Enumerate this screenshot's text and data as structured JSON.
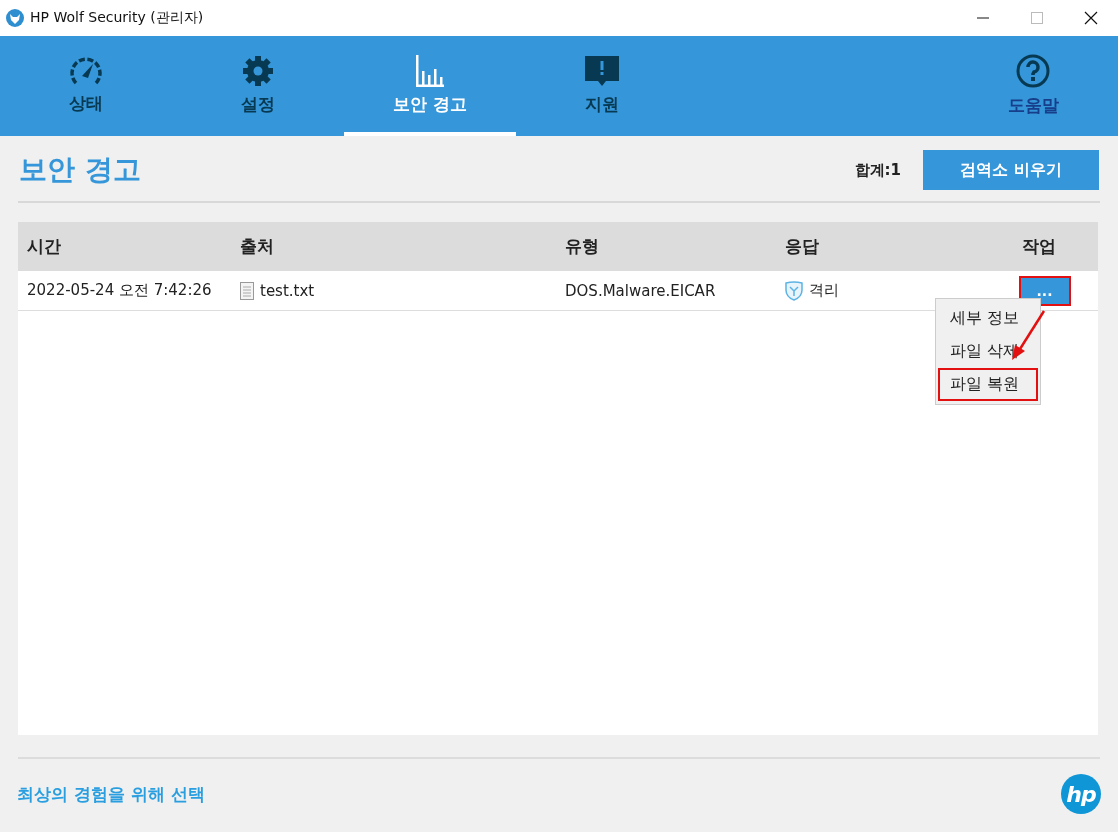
{
  "window": {
    "title": "HP Wolf Security (관리자)"
  },
  "nav": [
    {
      "label": "상태",
      "kind": "gauge",
      "selected": false
    },
    {
      "label": "설정",
      "kind": "gear",
      "selected": false
    },
    {
      "label": "보안 경고",
      "kind": "chart",
      "selected": true
    },
    {
      "label": "지원",
      "kind": "alert",
      "selected": false
    }
  ],
  "help": {
    "label": "도움말"
  },
  "page": {
    "title": "보안 경고",
    "total_label": "합계:",
    "total": "1",
    "clear_button": "검역소 비우기"
  },
  "table": {
    "columns": [
      "시간",
      "출처",
      "유형",
      "응답",
      "작업"
    ],
    "rows": [
      {
        "time": "2022-05-24 오전 7:42:26",
        "source": "test.txt",
        "type": "DOS.Malware.EICAR",
        "response": "격리",
        "action": "...",
        "highlighted": true
      }
    ]
  },
  "menu": {
    "items": [
      {
        "label": "세부 정보",
        "highlighted": false
      },
      {
        "label": "파일 삭제",
        "highlighted": false
      },
      {
        "label": "파일 복원",
        "highlighted": true
      }
    ],
    "arrow": true
  },
  "footer": {
    "link": "최상의 경험을 위해 선택",
    "logo": "hp"
  }
}
